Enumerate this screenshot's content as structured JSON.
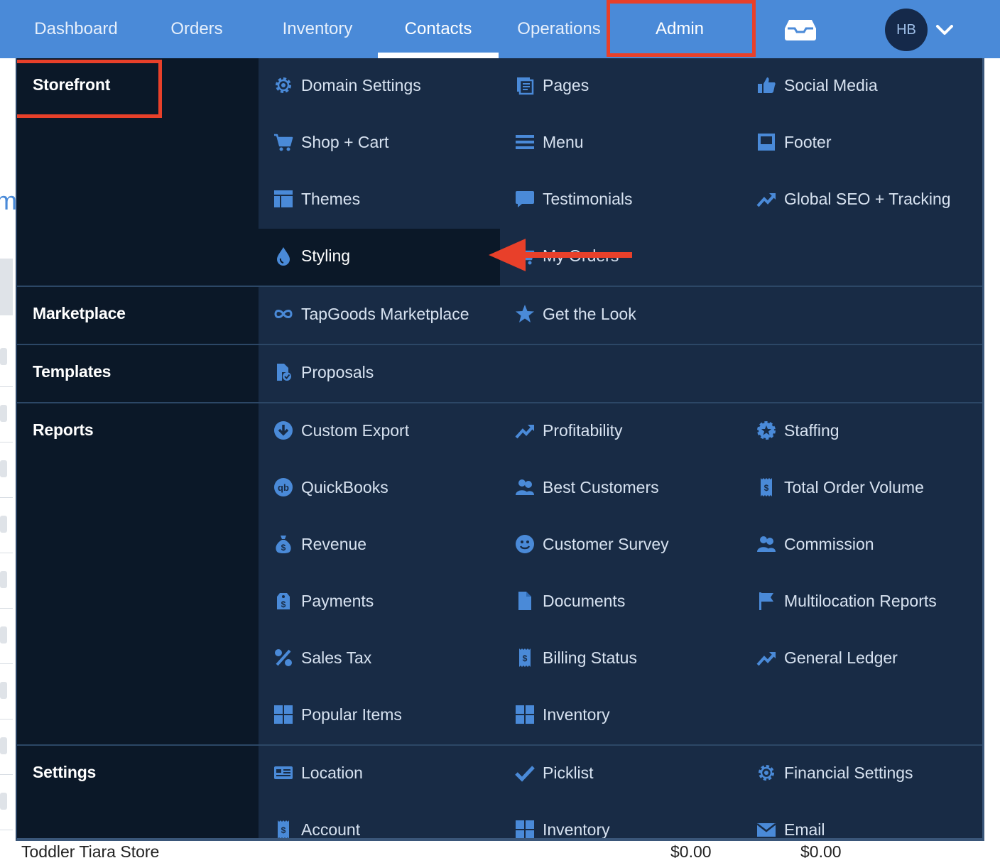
{
  "nav": {
    "tabs": [
      {
        "label": "Dashboard"
      },
      {
        "label": "Orders"
      },
      {
        "label": "Inventory"
      },
      {
        "label": "Contacts"
      },
      {
        "label": "Operations"
      },
      {
        "label": "Admin"
      }
    ],
    "active_tab": "Contacts",
    "highlighted_tab": "Admin",
    "avatar_initials": "HB",
    "inbox_icon": "inbox-icon",
    "dropdown_icon": "chevron-down-icon"
  },
  "menu": {
    "sections": [
      {
        "category": "Storefront",
        "items": [
          {
            "label": "Domain Settings",
            "icon": "gear-icon"
          },
          {
            "label": "Pages",
            "icon": "pages-icon"
          },
          {
            "label": "Social Media",
            "icon": "thumbs-up-icon"
          },
          {
            "label": "Shop + Cart",
            "icon": "cart-icon"
          },
          {
            "label": "Menu",
            "icon": "menu-bars-icon"
          },
          {
            "label": "Footer",
            "icon": "footer-icon"
          },
          {
            "label": "Themes",
            "icon": "layout-icon"
          },
          {
            "label": "Testimonials",
            "icon": "comment-icon"
          },
          {
            "label": "Global SEO + Tracking",
            "icon": "trend-up-icon"
          },
          {
            "label": "Styling",
            "icon": "droplet-icon"
          },
          {
            "label": "My Orders",
            "icon": "cart-icon"
          }
        ]
      },
      {
        "category": "Marketplace",
        "items": [
          {
            "label": "TapGoods Marketplace",
            "icon": "infinity-icon"
          },
          {
            "label": "Get the Look",
            "icon": "star-icon"
          }
        ]
      },
      {
        "category": "Templates",
        "items": [
          {
            "label": "Proposals",
            "icon": "file-check-icon"
          }
        ]
      },
      {
        "category": "Reports",
        "items": [
          {
            "label": "Custom Export",
            "icon": "download-circle-icon"
          },
          {
            "label": "Profitability",
            "icon": "trend-up-icon"
          },
          {
            "label": "Staffing",
            "icon": "badge-star-icon"
          },
          {
            "label": "QuickBooks",
            "icon": "quickbooks-icon"
          },
          {
            "label": "Best Customers",
            "icon": "users-icon"
          },
          {
            "label": "Total Order Volume",
            "icon": "receipt-icon"
          },
          {
            "label": "Revenue",
            "icon": "money-bag-icon"
          },
          {
            "label": "Customer Survey",
            "icon": "smile-icon"
          },
          {
            "label": "Commission",
            "icon": "users-icon"
          },
          {
            "label": "Payments",
            "icon": "price-tag-icon"
          },
          {
            "label": "Documents",
            "icon": "document-icon"
          },
          {
            "label": "Multilocation Reports",
            "icon": "flag-icon"
          },
          {
            "label": "Sales Tax",
            "icon": "percent-icon"
          },
          {
            "label": "Billing Status",
            "icon": "receipt-icon"
          },
          {
            "label": "General Ledger",
            "icon": "trend-up-icon"
          },
          {
            "label": "Popular Items",
            "icon": "grid-icon"
          },
          {
            "label": "Inventory",
            "icon": "grid-icon"
          }
        ]
      },
      {
        "category": "Settings",
        "items": [
          {
            "label": "Location",
            "icon": "id-card-icon"
          },
          {
            "label": "Picklist",
            "icon": "check-icon"
          },
          {
            "label": "Financial Settings",
            "icon": "gear-icon"
          },
          {
            "label": "Account",
            "icon": "receipt-icon"
          },
          {
            "label": "Inventory",
            "icon": "grid-icon"
          },
          {
            "label": "Email",
            "icon": "envelope-icon"
          }
        ]
      }
    ],
    "highlighted_category": "Storefront",
    "pointed_item": "Styling"
  },
  "background_row": {
    "name": "Toddler Tiara Store",
    "value_1": "$0.00",
    "value_2": "$0.00"
  },
  "colors": {
    "nav_bg": "#4a8ad8",
    "menu_bg": "#182b45",
    "category_bg": "#0b1828",
    "icon": "#4a8ad8",
    "highlight": "#e8402a"
  }
}
